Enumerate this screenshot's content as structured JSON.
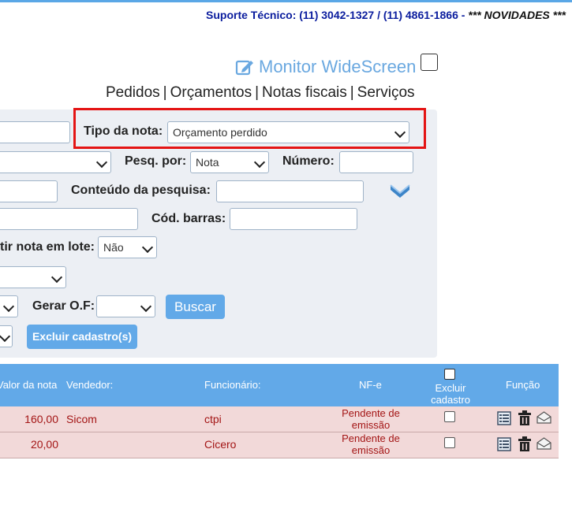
{
  "header": {
    "support_text": "Suporte Técnico: (11) 3042-1327 / (11) 4861-1866 - ",
    "novidades": "*** NOVIDADES ***",
    "monitor_label": "Monitor WideScreen"
  },
  "nav": {
    "pedidos": "Pedidos",
    "orcamentos": "Orçamentos",
    "notas_fiscais": "Notas fiscais",
    "servicos": "Serviços",
    "separator": "|"
  },
  "filters": {
    "tipo_nota_label": "Tipo da nota:",
    "tipo_nota_value": "Orçamento perdido",
    "pesq_por_label": "Pesq. por:",
    "pesq_por_value": "Nota",
    "numero_label": "Número:",
    "conteudo_label": "Conteúdo da pesquisa:",
    "cod_barras_label": "Cód. barras:",
    "lote_label": "tir nota em lote:",
    "lote_value": "Não",
    "gerar_of_label": "Gerar O.F:",
    "buscar_button": "Buscar",
    "excluir_cadastros_button": "Excluir cadastro(s)"
  },
  "table": {
    "headers": {
      "valor": "Valor da nota",
      "vendedor": "Vendedor:",
      "funcionario": "Funcionário:",
      "nfe": "NF-e",
      "excluir": "Excluir cadastro",
      "funcao": "Função"
    },
    "rows": [
      {
        "valor": "160,00",
        "vendedor": "Sicom",
        "funcionario": "ctpi",
        "nfe": "Pendente de emissão"
      },
      {
        "valor": "20,00",
        "vendedor": "",
        "funcionario": "Cicero",
        "nfe": "Pendente de emissão"
      }
    ]
  },
  "colors": {
    "accent": "#62a9e8",
    "highlight_border": "#e41414",
    "row_background": "#f2d9d9",
    "row_text": "#a31515",
    "support_text": "#0b1d9e"
  }
}
